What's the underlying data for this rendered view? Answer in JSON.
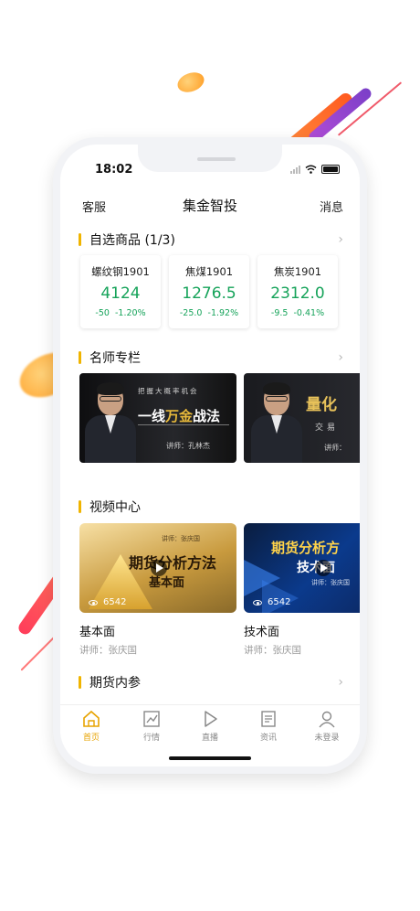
{
  "status": {
    "time": "18:02"
  },
  "nav": {
    "left": "客服",
    "title": "集金智投",
    "right": "消息"
  },
  "watchlist": {
    "title": "自选商品 (1/3)",
    "items": [
      {
        "name": "螺纹钢1901",
        "price": "4124",
        "change": "-50",
        "pct": "-1.20%"
      },
      {
        "name": "焦煤1901",
        "price": "1276.5",
        "change": "-25.0",
        "pct": "-1.92%"
      },
      {
        "name": "焦炭1901",
        "price": "2312.0",
        "change": "-9.5",
        "pct": "-0.41%"
      }
    ],
    "down_color": "#16a35a"
  },
  "columns": {
    "title": "名师专栏",
    "banners": [
      {
        "top": "把握大概率机会",
        "main_a": "一线",
        "main_b": "万金",
        "main_c": "战法",
        "teacher": "讲师：孔林杰"
      },
      {
        "main": "量化",
        "sub": "交易",
        "teacher": "讲师："
      }
    ]
  },
  "video": {
    "title": "视频中心",
    "items": [
      {
        "title": "基本面",
        "teacher": "讲师：张庆国",
        "poster_a": "期货分析方法",
        "poster_b": "基本面",
        "poster_teacher": "讲师：张庆国",
        "views": "6542"
      },
      {
        "title": "技术面",
        "teacher": "讲师：张庆国",
        "poster_a": "期货分析方",
        "poster_b": "技术面",
        "poster_teacher": "讲师：张庆国",
        "views": "6542"
      }
    ]
  },
  "futures": {
    "title": "期货内参"
  },
  "tabs": [
    {
      "label": "首页",
      "icon": "home-icon",
      "active": true
    },
    {
      "label": "行情",
      "icon": "chart-icon",
      "active": false
    },
    {
      "label": "直播",
      "icon": "play-icon",
      "active": false
    },
    {
      "label": "资讯",
      "icon": "document-icon",
      "active": false
    },
    {
      "label": "未登录",
      "icon": "user-icon",
      "active": false
    }
  ],
  "accent": "#f0b400"
}
